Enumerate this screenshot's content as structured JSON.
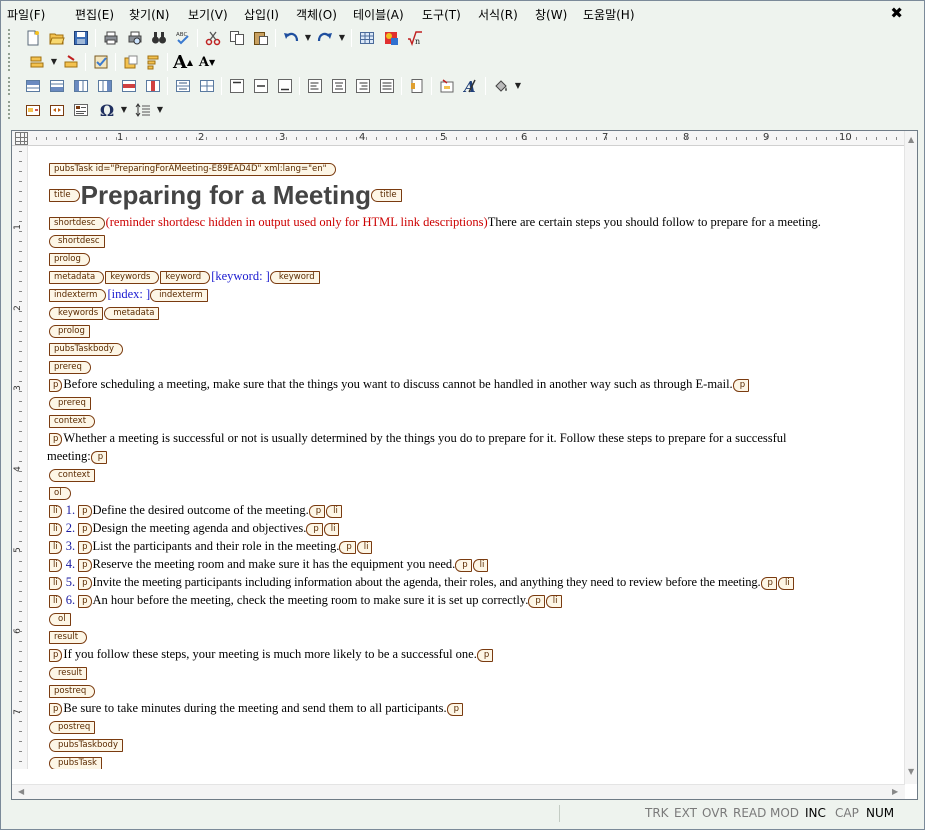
{
  "menubar": {
    "items": [
      "파일(F)",
      "편집(E)",
      "찾기(N)",
      "보기(V)",
      "삽입(I)",
      "객체(O)",
      "테이블(A)",
      "도구(T)",
      "서식(R)",
      "창(W)",
      "도움말(H)"
    ],
    "close_glyph": "✖"
  },
  "toolbar": {
    "row1": [
      "new-document-icon",
      "open-folder-icon",
      "save-icon",
      "print-icon",
      "print-preview-icon",
      "find-binoculars-icon",
      "spell-check-icon",
      "cut-icon",
      "copy-icon",
      "paste-icon",
      "undo-icon",
      "redo-icon",
      "table-icon",
      "image-icon",
      "equation-icon"
    ],
    "row2": [
      "insert-element-icon",
      "change-element-icon",
      "validate-icon",
      "attributes-icon",
      "element-list-icon"
    ],
    "row2_text": {
      "font_large": "A",
      "font_small": "A"
    },
    "row3": [
      "insert-row-above-icon",
      "insert-row-below-icon",
      "insert-col-left-icon",
      "insert-col-right-icon",
      "delete-row-icon",
      "delete-col-icon",
      "merge-cells-icon",
      "split-cells-icon",
      "valign-top-icon",
      "valign-middle-icon",
      "valign-bottom-icon",
      "align-left-icon",
      "align-center-icon",
      "align-right-icon",
      "justify-icon",
      "page-layout-icon",
      "link-icon",
      "style-icon",
      "fill-color-icon"
    ],
    "row4": [
      "show-tags-icon",
      "hide-tags-icon",
      "tag-view-icon",
      "symbol-icon",
      "line-spacing-icon"
    ],
    "row4_text": {
      "symbol": "Ω"
    }
  },
  "ruler": {
    "numbers": [
      "1",
      "2",
      "3",
      "4",
      "5",
      "6",
      "7",
      "8",
      "9",
      "10"
    ],
    "vnumbers": [
      "1",
      "2",
      "3",
      "4",
      "5",
      "6",
      "7"
    ]
  },
  "doc": {
    "pubstask_open": "pubsTask id=\"PreparingForAMeeting-E89EAD4D\" xml:lang=\"en\"",
    "title_tag": "title",
    "title_text": "Preparing for a Meeting",
    "shortdesc_tag": "shortdesc",
    "shortdesc_hidden": "(reminder shortdesc hidden in output used only for HTML link descriptions)",
    "shortdesc_text": "There are certain steps you should follow to prepare for a meeting.",
    "prolog_tag": "prolog",
    "metadata_tag": "metadata",
    "keywords_tag": "keywords",
    "keyword_tag": "keyword",
    "keyword_text": "[keyword: ]",
    "indexterm_tag": "indexterm",
    "indexterm_text": "[index: ]",
    "body_tag": "pubsTaskbody",
    "prereq_tag": "prereq",
    "p_tag": "p",
    "prereq_text": "Before scheduling a meeting, make sure that the things you want to discuss cannot be handled in another way such as through E-mail.",
    "context_tag": "context",
    "context_text_1": "Whether a meeting is successful or not is usually determined by the things you do to prepare for it. Follow these steps to prepare for a successful",
    "context_text_2": "meeting:",
    "ol_tag": "ol",
    "li_tag": "li",
    "steps": [
      {
        "num": "1.",
        "text": "Define the desired outcome of the meeting."
      },
      {
        "num": "2.",
        "text": "Design the meeting agenda and objectives."
      },
      {
        "num": "3.",
        "text": "List the participants and their role in the meeting."
      },
      {
        "num": "4.",
        "text": "Reserve the meeting room and make sure it has the equipment you need."
      },
      {
        "num": "5.",
        "text": "Invite the meeting participants including information about the agenda, their roles, and anything they need to review before the meeting."
      },
      {
        "num": "6.",
        "text": "An hour before the meeting, check the meeting room to make sure it is set up correctly."
      }
    ],
    "result_tag": "result",
    "result_text": "If you follow these steps, your meeting is much more likely to be a successful one.",
    "postreq_tag": "postreq",
    "postreq_text": "Be sure to take minutes during the meeting and send them to all participants."
  },
  "statusbar": {
    "items": [
      {
        "label": "TRK",
        "active": false
      },
      {
        "label": "EXT",
        "active": false
      },
      {
        "label": "OVR",
        "active": false
      },
      {
        "label": "READ",
        "active": false
      },
      {
        "label": "MOD",
        "active": false
      },
      {
        "label": "INC",
        "active": true
      },
      {
        "label": "CAP",
        "active": false
      },
      {
        "label": "NUM",
        "active": true
      }
    ]
  },
  "colors": {
    "tag_border": "#7a3b10",
    "tag_fill": "#fdf6e6",
    "hidden_text": "#cc0000",
    "placeholder_text": "#1a1ad0",
    "chrome_bg": "#eef3ee"
  }
}
